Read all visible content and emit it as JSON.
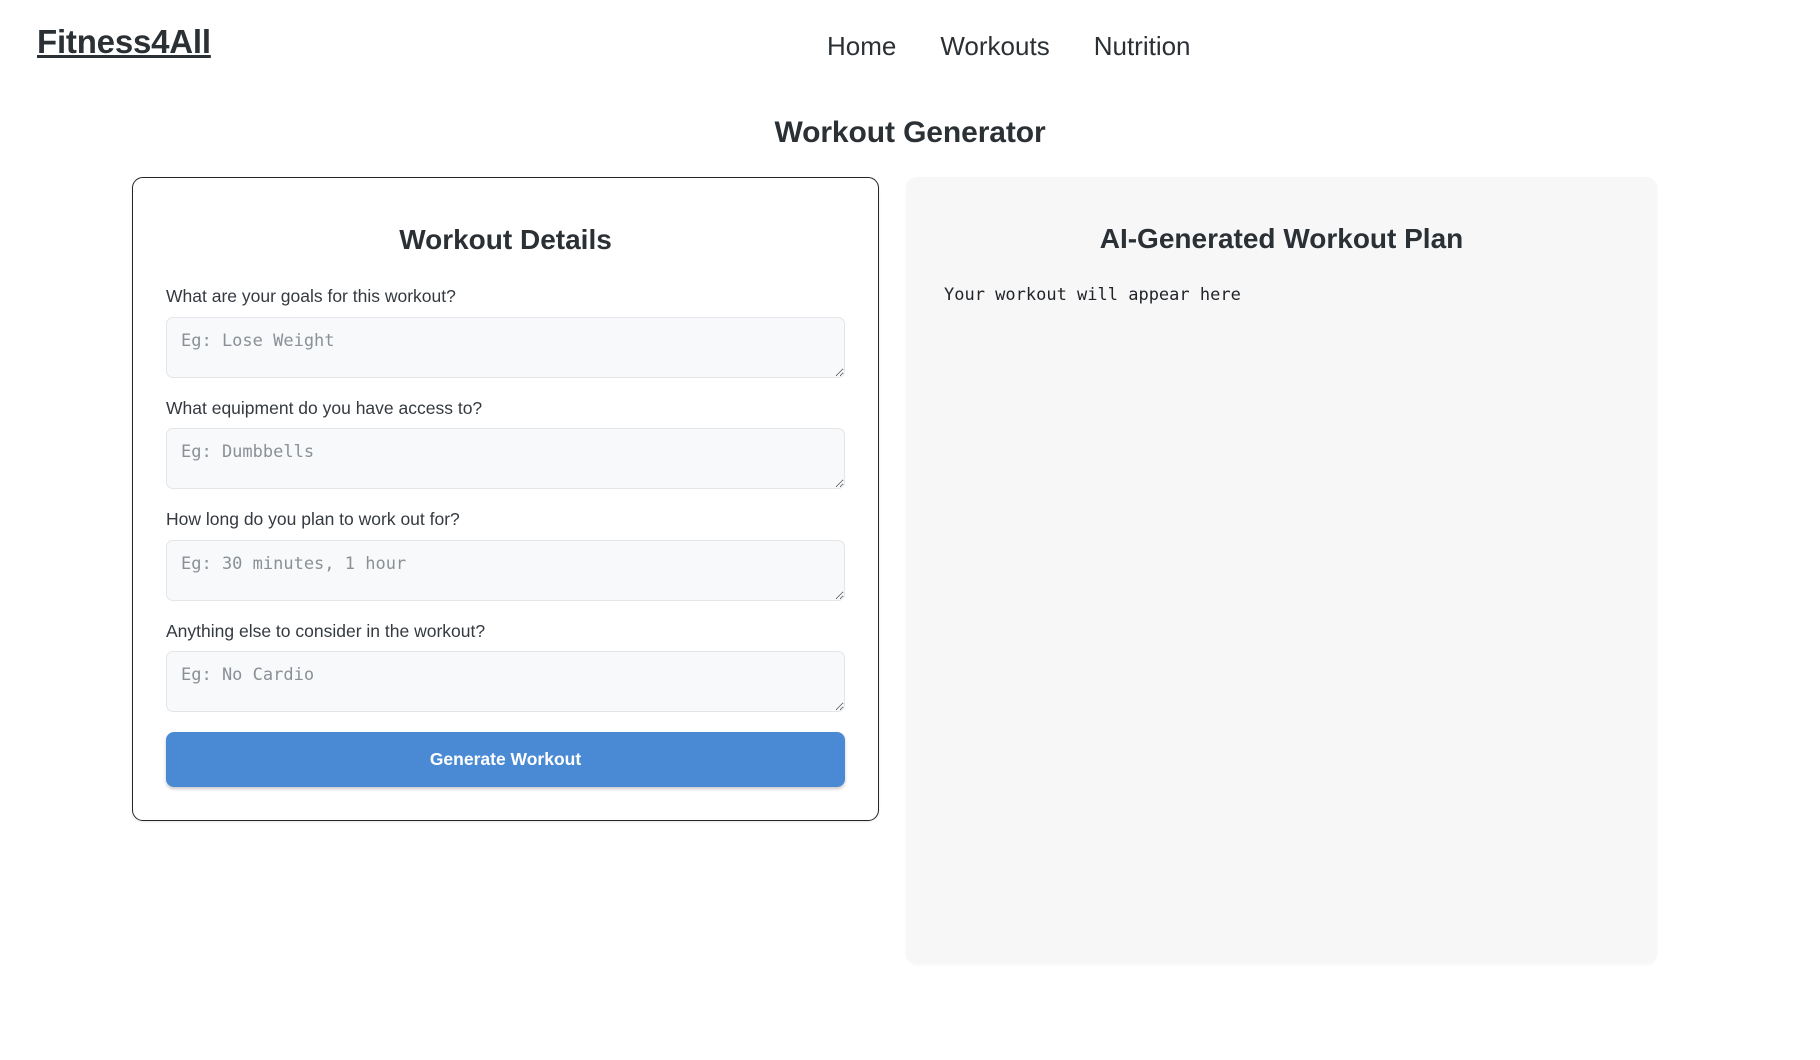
{
  "navbar": {
    "brand": "Fitness4All",
    "links": [
      {
        "label": "Home"
      },
      {
        "label": "Workouts"
      },
      {
        "label": "Nutrition"
      }
    ]
  },
  "page": {
    "title": "Workout Generator"
  },
  "form_card": {
    "heading": "Workout Details",
    "fields": [
      {
        "label": "What are your goals for this workout?",
        "placeholder": "Eg: Lose Weight",
        "value": ""
      },
      {
        "label": "What equipment do you have access to?",
        "placeholder": "Eg: Dumbbells",
        "value": ""
      },
      {
        "label": "How long do you plan to work out for?",
        "placeholder": "Eg: 30 minutes, 1 hour",
        "value": ""
      },
      {
        "label": "Anything else to consider in the workout?",
        "placeholder": "Eg: No Cardio",
        "value": ""
      }
    ],
    "submit_label": "Generate Workout"
  },
  "plan_panel": {
    "heading": "AI-Generated Workout Plan",
    "output_text": "Your workout will appear here"
  },
  "colors": {
    "accent": "#4a8ad4",
    "text": "#2b3035",
    "label": "#343a40",
    "panel_bg": "#f7f7f8",
    "input_bg": "#f8f9fa",
    "card_border": "#22262a",
    "placeholder": "#8a9096"
  }
}
